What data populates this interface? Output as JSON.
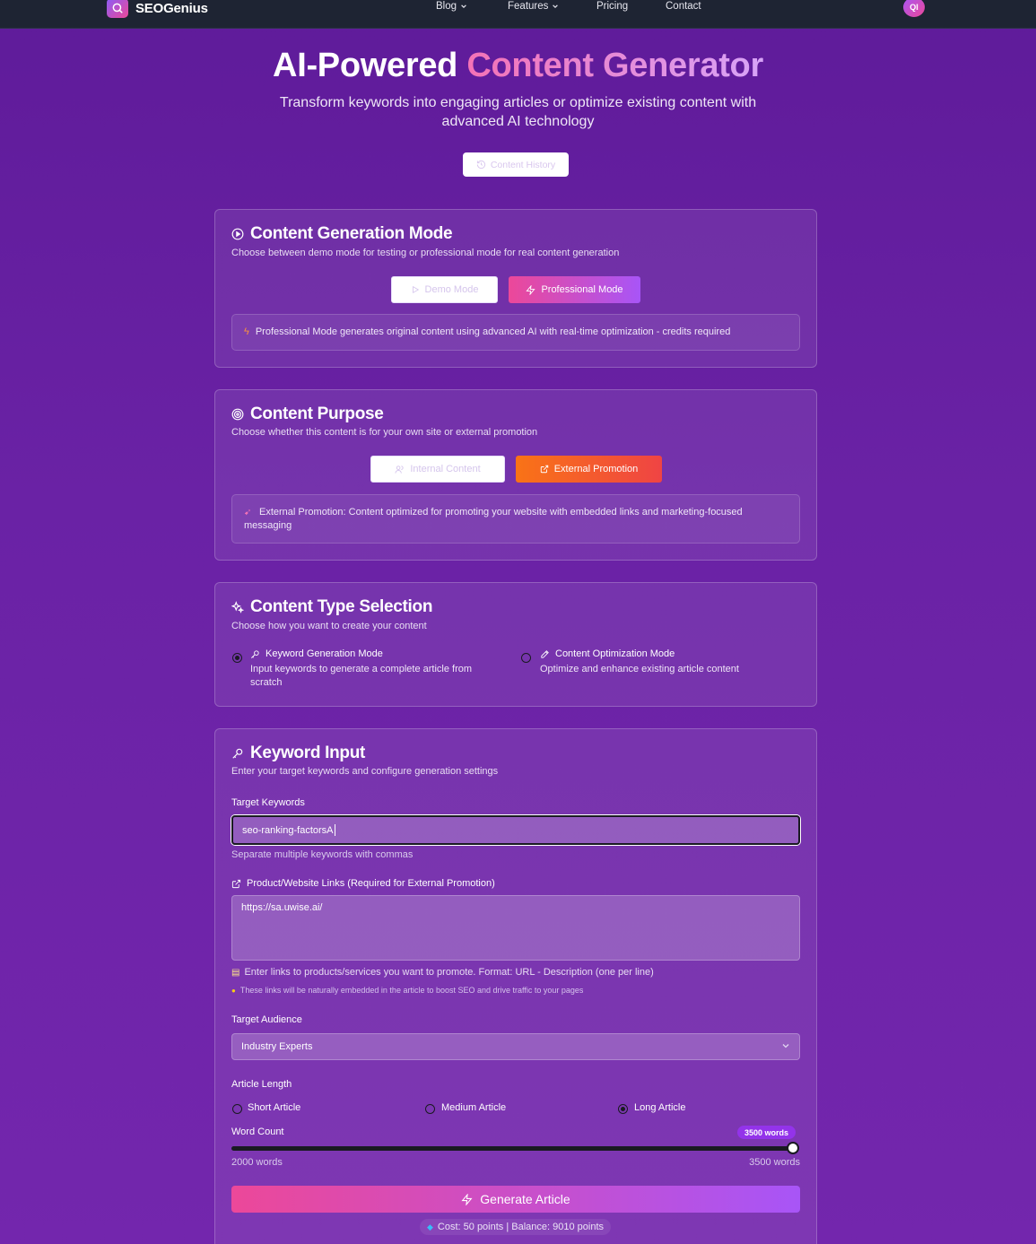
{
  "nav": {
    "brand": "SEOGenius",
    "links": [
      "Blog",
      "Features",
      "Pricing",
      "Contact"
    ],
    "avatar_initials": "QI"
  },
  "hero": {
    "title_plain": "AI-Powered",
    "title_highlight": "Content Generator",
    "subtitle": "Transform keywords into engaging articles or optimize existing content with advanced AI technology",
    "history_button": "Content History"
  },
  "mode_card": {
    "title": "Content Generation Mode",
    "desc": "Choose between demo mode for testing or professional mode for real content generation",
    "demo_button": "Demo Mode",
    "pro_button": "Professional Mode",
    "info": "Professional Mode generates original content using advanced AI with real-time optimization - credits required"
  },
  "purpose_card": {
    "title": "Content Purpose",
    "desc": "Choose whether this content is for your own site or external promotion",
    "internal_button": "Internal Content",
    "external_button": "External Promotion",
    "info": "External Promotion: Content optimized for promoting your website with embedded links and marketing-focused messaging"
  },
  "type_card": {
    "title": "Content Type Selection",
    "desc": "Choose how you want to create your content",
    "options": [
      {
        "title": "Keyword Generation Mode",
        "desc": "Input keywords to generate a complete article from scratch",
        "selected": true
      },
      {
        "title": "Content Optimization Mode",
        "desc": "Optimize and enhance existing article content",
        "selected": false
      }
    ]
  },
  "keyword_card": {
    "title": "Keyword Input",
    "desc": "Enter your target keywords and configure generation settings",
    "keywords_label": "Target Keywords",
    "keywords_value": "seo-ranking-factorsA",
    "keywords_hint": "Separate multiple keywords with commas",
    "links_label": "Product/Website Links (Required for External Promotion)",
    "links_value": "https://sa.uwise.ai/",
    "links_hint": "Enter links to products/services you want to promote. Format: URL - Description (one per line)",
    "links_tip": "These links will be naturally embedded in the article to boost SEO and drive traffic to your pages",
    "audience_label": "Target Audience",
    "audience_value": "Industry Experts",
    "length_label": "Article Length",
    "length_options": [
      {
        "label": "Short Article",
        "selected": false
      },
      {
        "label": "Medium Article",
        "selected": false
      },
      {
        "label": "Long Article",
        "selected": true
      }
    ],
    "wordcount_label": "Word Count",
    "wordcount_badge": "3500 words",
    "wordcount_value": 3500,
    "wordcount_min_label": "2000 words",
    "wordcount_max_label": "3500 words",
    "generate_button": "Generate Article",
    "cost_text": "Cost: 50 points | Balance: 9010 points"
  },
  "colors": {
    "accent_pink": "#ec4899",
    "accent_purple": "#a855f7",
    "accent_orange": "#f97316",
    "background": "#6a22a5",
    "nav_bg": "#1e2433"
  }
}
